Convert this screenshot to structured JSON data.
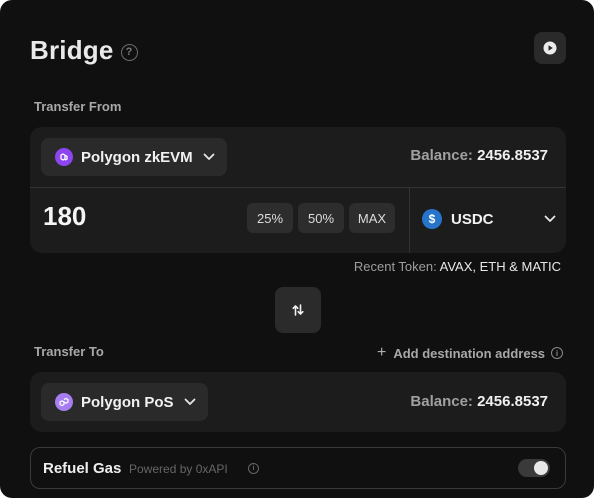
{
  "header": {
    "title": "Bridge",
    "help_glyph": "?"
  },
  "transfer_from": {
    "label": "Transfer From",
    "chain": {
      "name": "Polygon zkEVM",
      "icon": "polygon-zkevm-logo",
      "color": "#8c45f0"
    },
    "balance_label": "Balance:",
    "balance_value": "2456.8537",
    "amount": "180",
    "percent_buttons": [
      "25%",
      "50%",
      "MAX"
    ],
    "token": {
      "name": "USDC",
      "icon": "usdc-logo",
      "glyph": "$",
      "color": "#2775ca"
    }
  },
  "recent_tokens": {
    "label": "Recent Token:",
    "tokens": "AVAX, ETH & MATIC"
  },
  "transfer_to": {
    "label": "Transfer To",
    "add_destination": "Add destination address",
    "chain": {
      "name": "Polygon PoS",
      "icon": "polygon-pos-logo",
      "color": "#a77ef2"
    },
    "balance_label": "Balance:",
    "balance_value": "2456.8537"
  },
  "refuel": {
    "label": "Refuel Gas",
    "powered_by": "Powered by 0xAPI",
    "info_glyph": "i",
    "enabled": true
  }
}
